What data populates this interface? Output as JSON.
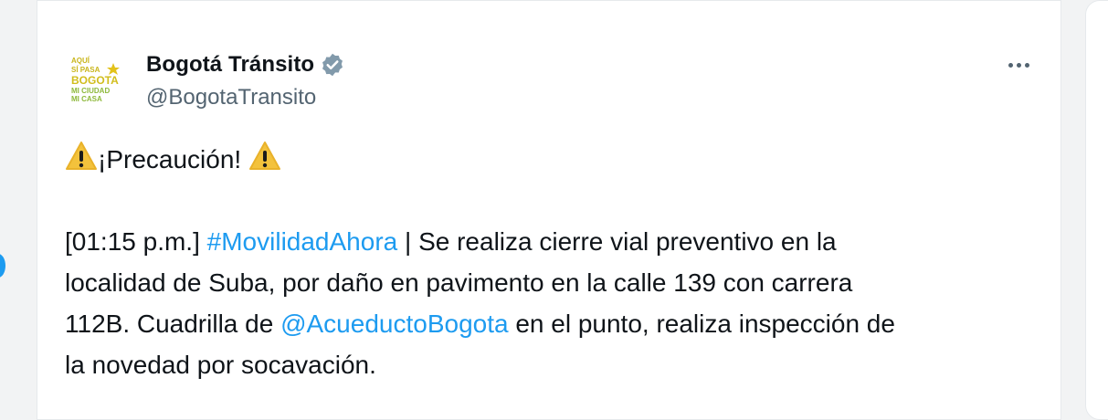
{
  "author": {
    "display_name": "Bogotá Tránsito",
    "handle": "@BogotaTransito",
    "logo_lines": [
      "AQUÍ",
      "SÍ PASA",
      "BOGOTA",
      "MI CIUDAD",
      "MI CASA"
    ]
  },
  "tweet": {
    "caution_text": "¡Precaución!",
    "time": "[01:15 p.m.]",
    "hashtag": "#MovilidadAhora",
    "text_1": " | Se realiza cierre vial preventivo en la",
    "text_2": "localidad de Suba, por daño en  pavimento en la calle 139 con carrera",
    "text_3": "112B. Cuadrilla de ",
    "mention": "@AcueductoBogota",
    "text_4": " en el punto, realiza inspección de",
    "text_5": "la novedad por socavación."
  },
  "icons": {
    "verified": "verified-badge-icon",
    "more": "more-options-icon",
    "warning": "warning-icon"
  },
  "colors": {
    "link": "#1d9bf0",
    "text": "#0f1419",
    "secondary": "#536471",
    "logo_yellow": "#d8c21f",
    "logo_green": "#8db83a"
  }
}
